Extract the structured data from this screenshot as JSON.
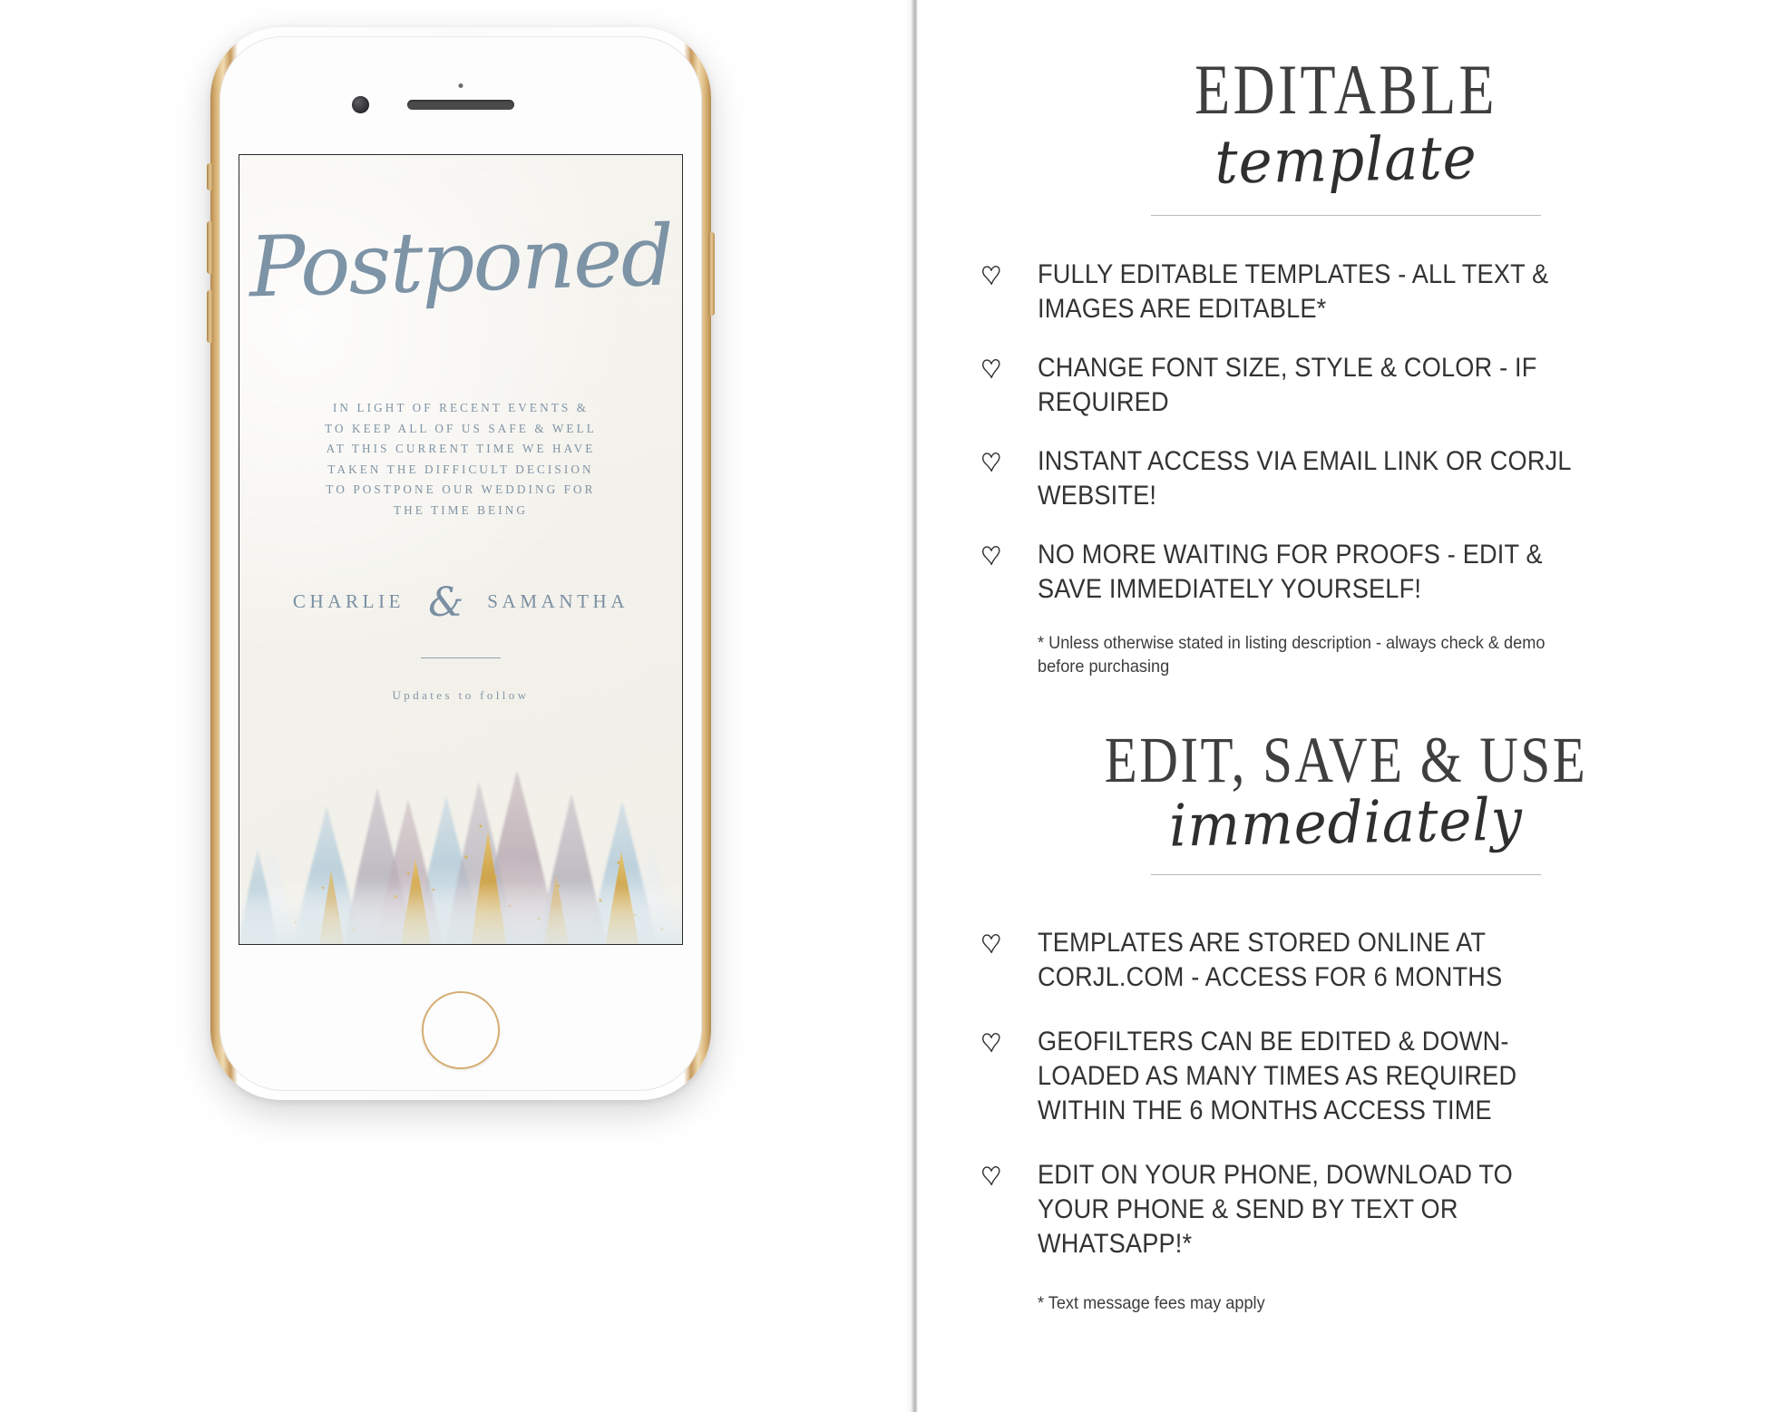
{
  "phone_card": {
    "title": "Postponed",
    "body_lines": [
      "IN LIGHT OF RECENT EVENTS &",
      "TO KEEP ALL OF US SAFE & WELL",
      "AT THIS CURRENT TIME WE HAVE",
      "TAKEN THE DIFFICULT DECISION",
      "TO POSTPONE OUR WEDDING FOR",
      "THE TIME BEING"
    ],
    "name_left": "CHARLIE",
    "ampersand": "&",
    "name_right": "SAMANTHA",
    "updates": "Updates to follow",
    "colors": {
      "script_blue": "#7d93a6",
      "body_blue": "#7f93a4",
      "paper": "#f6f4ee"
    }
  },
  "right_panel": {
    "heading_one": {
      "line1": "EDITABLE",
      "line2": "template"
    },
    "bullets_one": [
      "FULLY EDITABLE TEMPLATES - ALL TEXT & IMAGES ARE EDITABLE*",
      "CHANGE FONT SIZE, STYLE & COLOR - IF REQUIRED",
      "INSTANT ACCESS VIA EMAIL LINK OR CORJL WEBSITE!",
      "NO MORE WAITING FOR PROOFS - EDIT & SAVE IMMEDIATELY YOURSELF!"
    ],
    "footnote_one": "* Unless otherwise stated in listing description - always check & demo before purchasing",
    "heading_two": {
      "line1": "EDIT, SAVE & USE",
      "line2": "immediately"
    },
    "bullets_two": [
      "TEMPLATES ARE STORED ONLINE AT CORJL.COM - ACCESS FOR 6 MONTHS",
      "GEOFILTERS CAN BE EDITED & DOWN-LOADED AS MANY TIMES AS REQUIRED WITHIN THE 6 MONTHS ACCESS TIME",
      "EDIT ON YOUR PHONE, DOWNLOAD TO YOUR PHONE & SEND BY TEXT OR WHATSAPP!*"
    ],
    "footnote_two": "* Text message fees may apply",
    "bullet_icon": "heart-outline-icon",
    "text_color": "#333333"
  }
}
